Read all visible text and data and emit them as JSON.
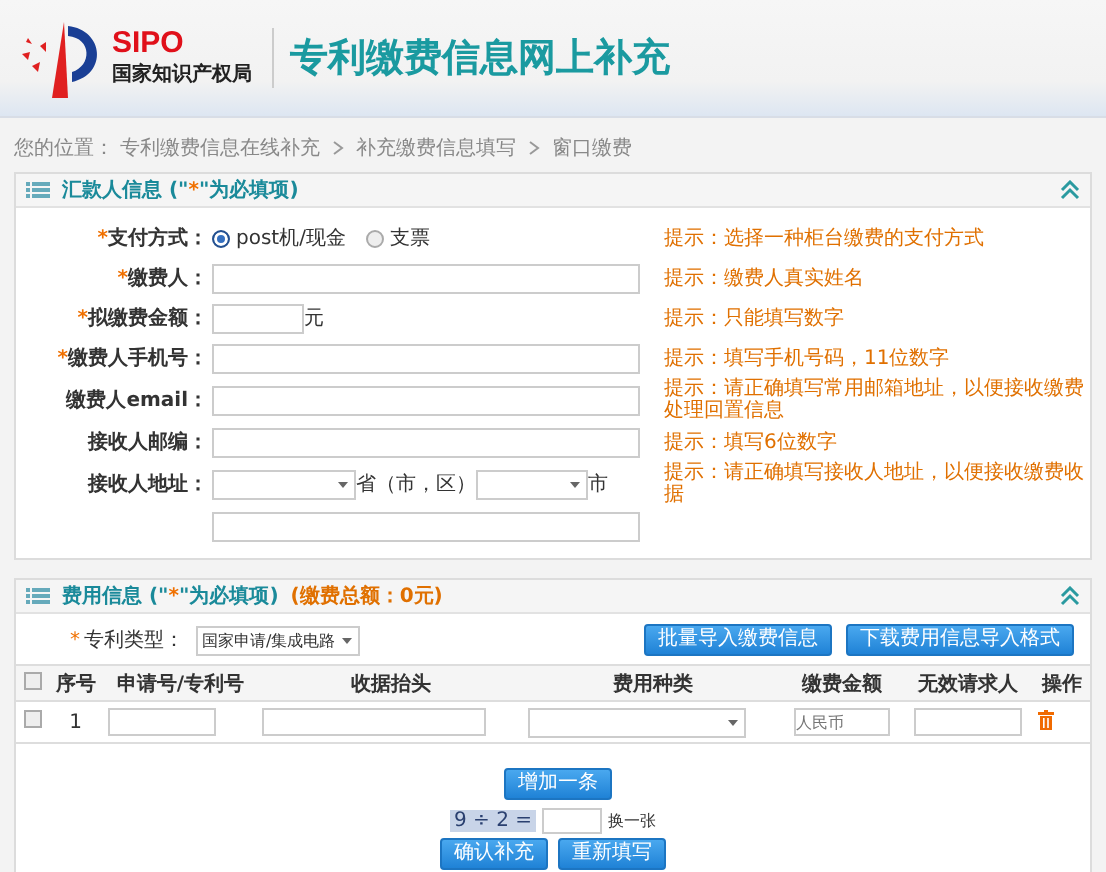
{
  "header": {
    "logo_text": "SIPO",
    "logo_subtitle": "国家知识产权局",
    "title": "专利缴费信息网上补充"
  },
  "breadcrumb": {
    "prefix": "您的位置：",
    "items": [
      "专利缴费信息在线补充",
      "补充缴费信息填写",
      "窗口缴费"
    ]
  },
  "payer_panel": {
    "title": "汇款人信息",
    "note_prefix": "(\"",
    "note_mark": "*",
    "note_suffix": "\"为必填项)",
    "expanded": true,
    "fields": [
      {
        "kind": "radio",
        "label": "支付方式：",
        "required": true,
        "options": [
          {
            "label": "post机/现金",
            "selected": true
          },
          {
            "label": "支票",
            "selected": false
          }
        ],
        "hint": "提示：选择一种柜台缴费的支付方式"
      },
      {
        "kind": "text",
        "label": "缴费人：",
        "required": true,
        "hint": "提示：缴费人真实姓名"
      },
      {
        "kind": "amount",
        "label": "拟缴费金额：",
        "required": true,
        "unit": "元",
        "hint": "提示：只能填写数字"
      },
      {
        "kind": "text",
        "label": "缴费人手机号：",
        "required": true,
        "hint": "提示：填写手机号码，11位数字"
      },
      {
        "kind": "text",
        "label": "缴费人email：",
        "required": false,
        "hint": "提示：请正确填写常用邮箱地址，以便接收缴费处理回置信息"
      },
      {
        "kind": "text",
        "label": "接收人邮编：",
        "required": false,
        "hint": "提示：填写6位数字"
      },
      {
        "kind": "address",
        "label": "接收人地址：",
        "required": false,
        "province_suffix": "省（市，区）",
        "city_suffix": "市",
        "hint": "提示：请正确填写接收人地址，以便接收缴费收据"
      }
    ]
  },
  "fee_panel": {
    "title": "费用信息",
    "note_prefix": "(\"",
    "note_mark": "*",
    "note_suffix": "\"为必填项)",
    "total": "(缴费总额：0元)",
    "expanded": true,
    "patent_type": {
      "label": "专利类型：",
      "required": true,
      "value": "国家申请/集成电路"
    },
    "buttons": [
      "批量导入缴费信息",
      "下载费用信息导入格式"
    ],
    "table": {
      "select_all_checked": false,
      "columns": [
        "序号",
        "申请号/专利号",
        "收据抬头",
        "费用种类",
        "缴费金额",
        "无效请求人",
        "操作"
      ],
      "rows": [
        {
          "checked": false,
          "index": "1",
          "amount_placeholder": "人民币"
        }
      ]
    },
    "add_button": "增加一条",
    "captcha": "9 ÷ 2 =",
    "refresh_link": "换一张",
    "submit_button": "确认补充",
    "reset_button": "重新填写"
  }
}
